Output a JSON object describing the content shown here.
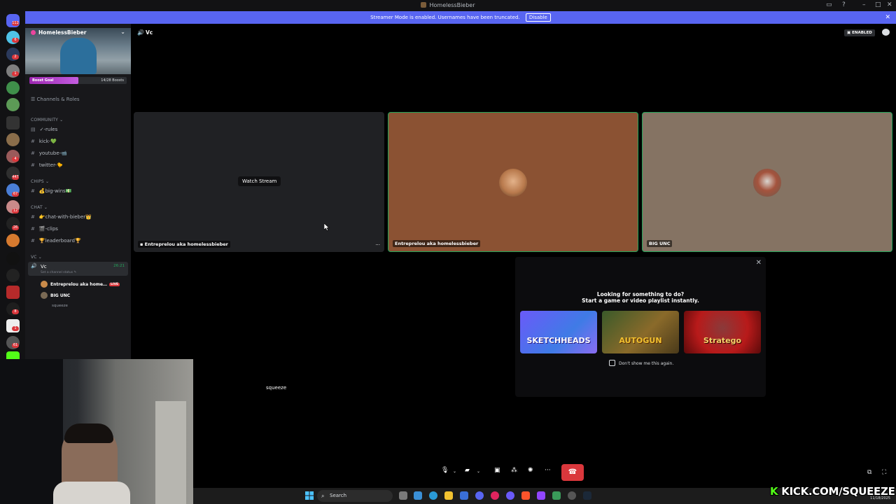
{
  "window": {
    "title": "HomelessBieber"
  },
  "banner": {
    "text": "Streamer Mode is enabled. Usernames have been truncated.",
    "disable_label": "Disable"
  },
  "server": {
    "name": "HomelessBieber",
    "boost_label": "Boost Goal",
    "boost_count": "14/28 Boosts",
    "boost_progress": 0.5
  },
  "rail_badges": [
    "112",
    "6",
    "2",
    "1",
    "4",
    "447",
    "67",
    "12",
    "26",
    "8",
    "1",
    "61"
  ],
  "sidebar": {
    "channels_roles": "Channels & Roles",
    "categories": {
      "community": "COMMUNITY",
      "chips": "CHIPS",
      "chat": "CHAT",
      "vc": "VC"
    },
    "channels": {
      "rules": "✓-rules",
      "kick": "kick-💚",
      "youtube": "youtube-📹",
      "twitter": "twitter-🐤",
      "bigwins": "💰big-wins💵",
      "chatwithbieber": "👉chat-with-bieber👑",
      "clips": "🎬-clips",
      "leaderboard": "🏆leaderboard🏆"
    },
    "voice": {
      "name": "Vc",
      "time": "26:21",
      "status": "Set a channel status ✎",
      "members": [
        "Entreprelou aka home…",
        "BIG UNC",
        "squeeze"
      ],
      "live_label": "LIVE"
    }
  },
  "main": {
    "header": "Vc",
    "enabled_label": "ENABLED",
    "tiles": [
      {
        "name": "Entreprelou aka homelessbieber",
        "action": "Watch Stream"
      },
      {
        "name": "Entreprelou aka homelessbieber"
      },
      {
        "name": "BIG UNC"
      }
    ],
    "squeeze_label": "squeeze"
  },
  "popup": {
    "line1": "Looking for something to do?",
    "line2": "Start a game or video playlist instantly.",
    "games": [
      "SKETCHHEADS",
      "AUTOGUN",
      "Stratego"
    ],
    "checkbox_label": "Don't show me this again."
  },
  "taskbar": {
    "search_placeholder": "Search",
    "date": "11/18/2025"
  },
  "overlay": {
    "kick_prefix": "K",
    "kick_text": "KICK.COM/SQUEEZE"
  },
  "colors": {
    "accent": "#5865f2",
    "live": "#da373c",
    "kick": "#53fc18",
    "tile_brown": "#8b5233",
    "tile_taupe": "#857363"
  }
}
